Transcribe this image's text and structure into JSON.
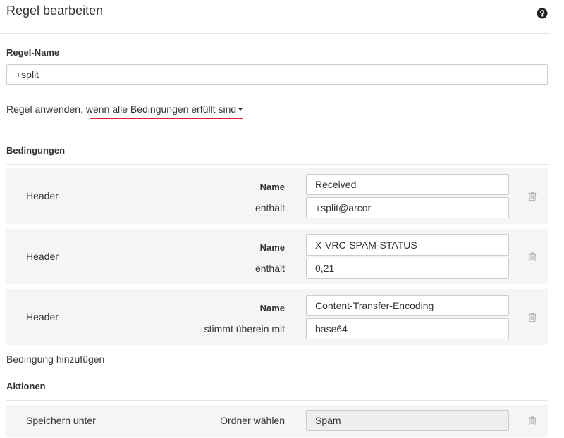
{
  "header": {
    "title": "Regel bearbeiten",
    "help_icon": "question-circle-icon"
  },
  "rule_name": {
    "label": "Regel-Name",
    "value": "+split"
  },
  "apply": {
    "prefix": "Regel anwenden,",
    "selected": "wenn alle Bedingungen erfüllt sind",
    "accent_color": "#d9262c"
  },
  "conditions": {
    "title": "Bedingungen",
    "items": [
      {
        "type": "Header",
        "name_label": "Name",
        "name_value": "Received",
        "op_label": "enthält",
        "op_value": "+split@arcor"
      },
      {
        "type": "Header",
        "name_label": "Name",
        "name_value": "X-VRC-SPAM-STATUS",
        "op_label": "enthält",
        "op_value": "0,21"
      },
      {
        "type": "Header",
        "name_label": "Name",
        "name_value": "Content-Transfer-Encoding",
        "op_label": "stimmt überein mit",
        "op_value": "base64"
      }
    ],
    "add_label": "Bedingung hinzufügen"
  },
  "actions": {
    "title": "Aktionen",
    "items": [
      {
        "type": "Speichern unter",
        "field_label": "Ordner wählen",
        "value": "Spam"
      }
    ]
  }
}
